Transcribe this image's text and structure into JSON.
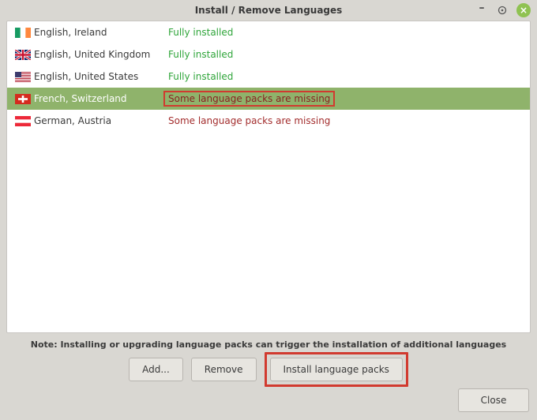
{
  "window": {
    "title": "Install / Remove Languages"
  },
  "languages": [
    {
      "flag": "ireland",
      "name": "English, Ireland",
      "status_key": "full",
      "selected": false,
      "highlight": false
    },
    {
      "flag": "uk",
      "name": "English, United Kingdom",
      "status_key": "full",
      "selected": false,
      "highlight": false
    },
    {
      "flag": "usa",
      "name": "English, United States",
      "status_key": "full",
      "selected": false,
      "highlight": false
    },
    {
      "flag": "switzerland",
      "name": "French, Switzerland",
      "status_key": "miss",
      "selected": true,
      "highlight": true
    },
    {
      "flag": "austria",
      "name": "German, Austria",
      "status_key": "miss",
      "selected": false,
      "highlight": false
    }
  ],
  "status_text": {
    "full": "Fully installed",
    "miss": "Some language packs are missing"
  },
  "note": "Note: Installing or upgrading language packs can trigger the installation of additional languages",
  "buttons": {
    "add": "Add...",
    "remove": "Remove",
    "install": "Install language packs",
    "close": "Close"
  }
}
